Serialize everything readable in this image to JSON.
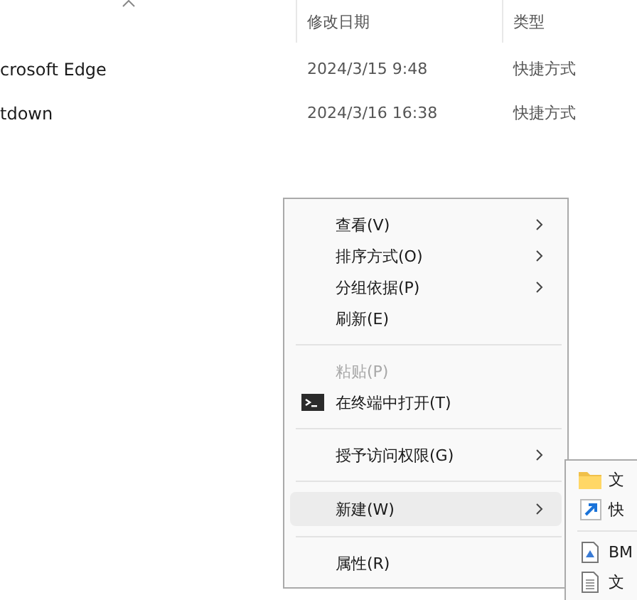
{
  "columns": [
    {
      "label": "修改日期"
    },
    {
      "label": "类型"
    }
  ],
  "rows": [
    {
      "name": "crosoft Edge",
      "date": "2024/3/15 9:48",
      "type": "快捷方式"
    },
    {
      "name": "tdown",
      "date": "2024/3/16 16:38",
      "type": "快捷方式"
    }
  ],
  "context_menu": {
    "items": [
      {
        "kind": "item",
        "label": "查看(V)",
        "submenu": true,
        "disabled": false,
        "selected": false
      },
      {
        "kind": "item",
        "label": "排序方式(O)",
        "submenu": true,
        "disabled": false,
        "selected": false
      },
      {
        "kind": "item",
        "label": "分组依据(P)",
        "submenu": true,
        "disabled": false,
        "selected": false
      },
      {
        "kind": "item",
        "label": "刷新(E)",
        "submenu": false,
        "disabled": false,
        "selected": false
      },
      {
        "kind": "separator"
      },
      {
        "kind": "item",
        "label": "粘贴(P)",
        "submenu": false,
        "disabled": true,
        "selected": false
      },
      {
        "kind": "terminal",
        "label": "在终端中打开(T)",
        "submenu": false,
        "disabled": false,
        "selected": false
      },
      {
        "kind": "separator"
      },
      {
        "kind": "item",
        "label": "授予访问权限(G)",
        "submenu": true,
        "disabled": false,
        "selected": false
      },
      {
        "kind": "separator"
      },
      {
        "kind": "item",
        "label": "新建(W)",
        "submenu": true,
        "disabled": false,
        "selected": true
      },
      {
        "kind": "separator"
      },
      {
        "kind": "item",
        "label": "属性(R)",
        "submenu": false,
        "disabled": false,
        "selected": false
      }
    ]
  },
  "submenu": {
    "items": [
      {
        "kind": "folder",
        "label": "文"
      },
      {
        "kind": "shortcut",
        "label": "快"
      },
      {
        "kind": "separator"
      },
      {
        "kind": "image",
        "label": "BM"
      },
      {
        "kind": "document",
        "label": "文"
      }
    ]
  }
}
